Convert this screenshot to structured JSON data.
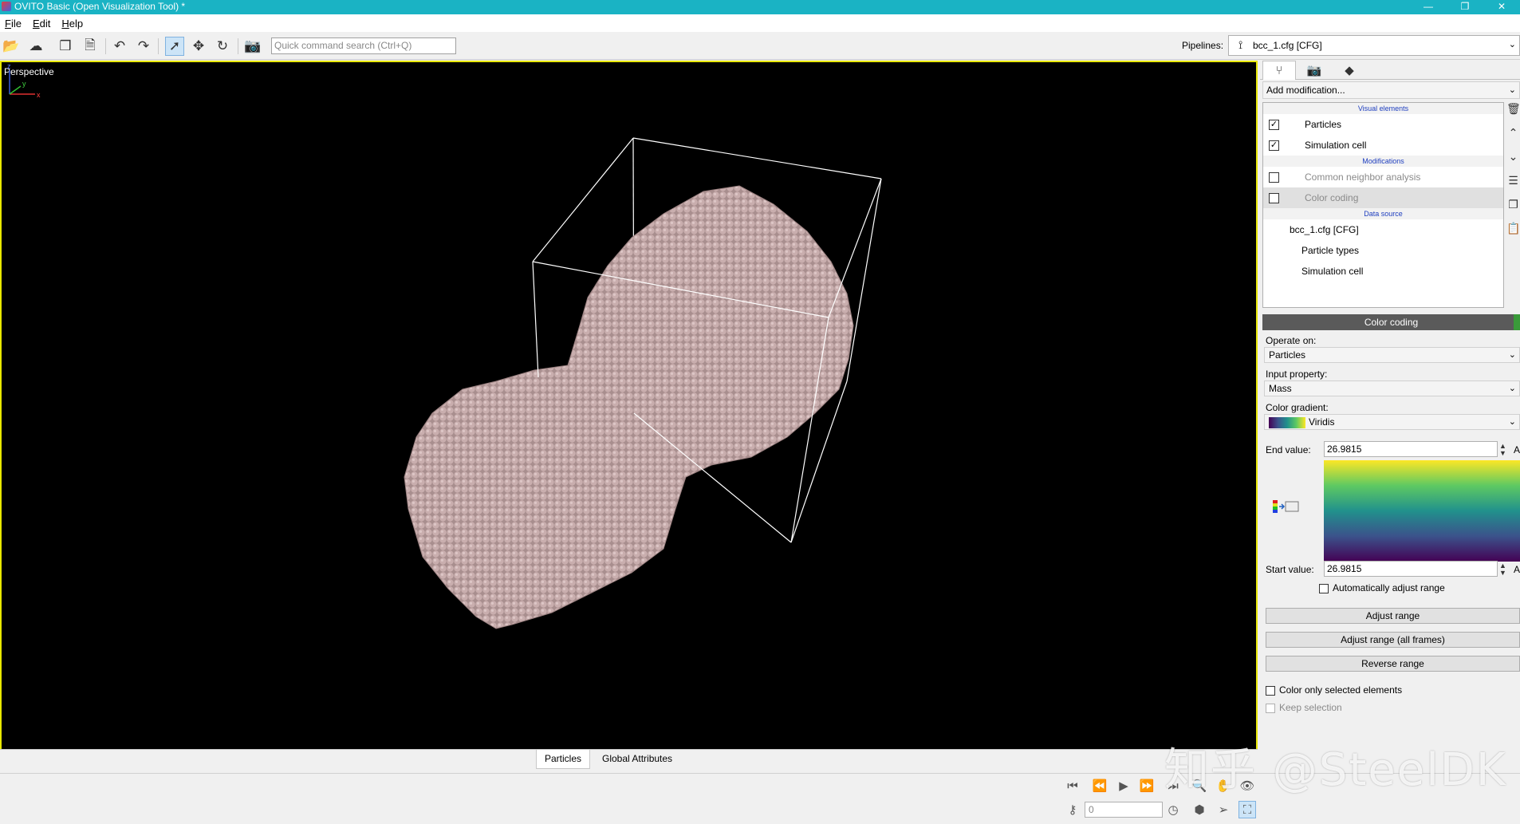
{
  "window": {
    "title": "OVITO Basic (Open Visualization Tool) *",
    "minimize": "—",
    "restore": "❐",
    "close": "✕"
  },
  "menu": [
    "File",
    "Edit",
    "Help"
  ],
  "toolbar": {
    "search_placeholder": "Quick command search (Ctrl+Q)",
    "pipelines_label": "Pipelines:",
    "pipeline_selected": "bcc_1.cfg [CFG]"
  },
  "viewport": {
    "label": "Perspective",
    "axis_labels": [
      "z",
      "y",
      "x"
    ],
    "colors": {
      "background": "#000000",
      "particles": "#c3a8a8",
      "cell": "#ffffff",
      "active_border": "#e8e800"
    }
  },
  "bottom_tabs": [
    "Particles",
    "Global Attributes"
  ],
  "animation": {
    "frame_value": "0"
  },
  "side_panel": {
    "add_modification": "Add modification...",
    "sections": {
      "visual": "Visual elements",
      "modifications": "Modifications",
      "data_source": "Data source"
    },
    "visual_elements": [
      {
        "label": "Particles",
        "checked": true
      },
      {
        "label": "Simulation cell",
        "checked": true
      }
    ],
    "modifications": [
      {
        "label": "Common neighbor analysis",
        "checked": false
      },
      {
        "label": "Color coding",
        "checked": false
      }
    ],
    "data_source": {
      "file": "bcc_1.cfg [CFG]",
      "children": [
        "Particle types",
        "Simulation cell"
      ]
    }
  },
  "color_coding": {
    "header": "Color coding",
    "operate_on_label": "Operate on:",
    "operate_on_value": "Particles",
    "input_property_label": "Input property:",
    "input_property_value": "Mass",
    "color_gradient_label": "Color gradient:",
    "color_gradient_value": "Viridis",
    "end_value_label": "End value:",
    "end_value": "26.9815",
    "start_value_label": "Start value:",
    "start_value": "26.9815",
    "a_label": "A",
    "auto_adjust_label": "Automatically adjust range",
    "adjust_range": "Adjust range",
    "adjust_range_all": "Adjust range (all frames)",
    "reverse_range": "Reverse range",
    "color_only_selected": "Color only selected elements",
    "keep_selection": "Keep selection"
  },
  "watermark": "知乎 @SteelDK"
}
